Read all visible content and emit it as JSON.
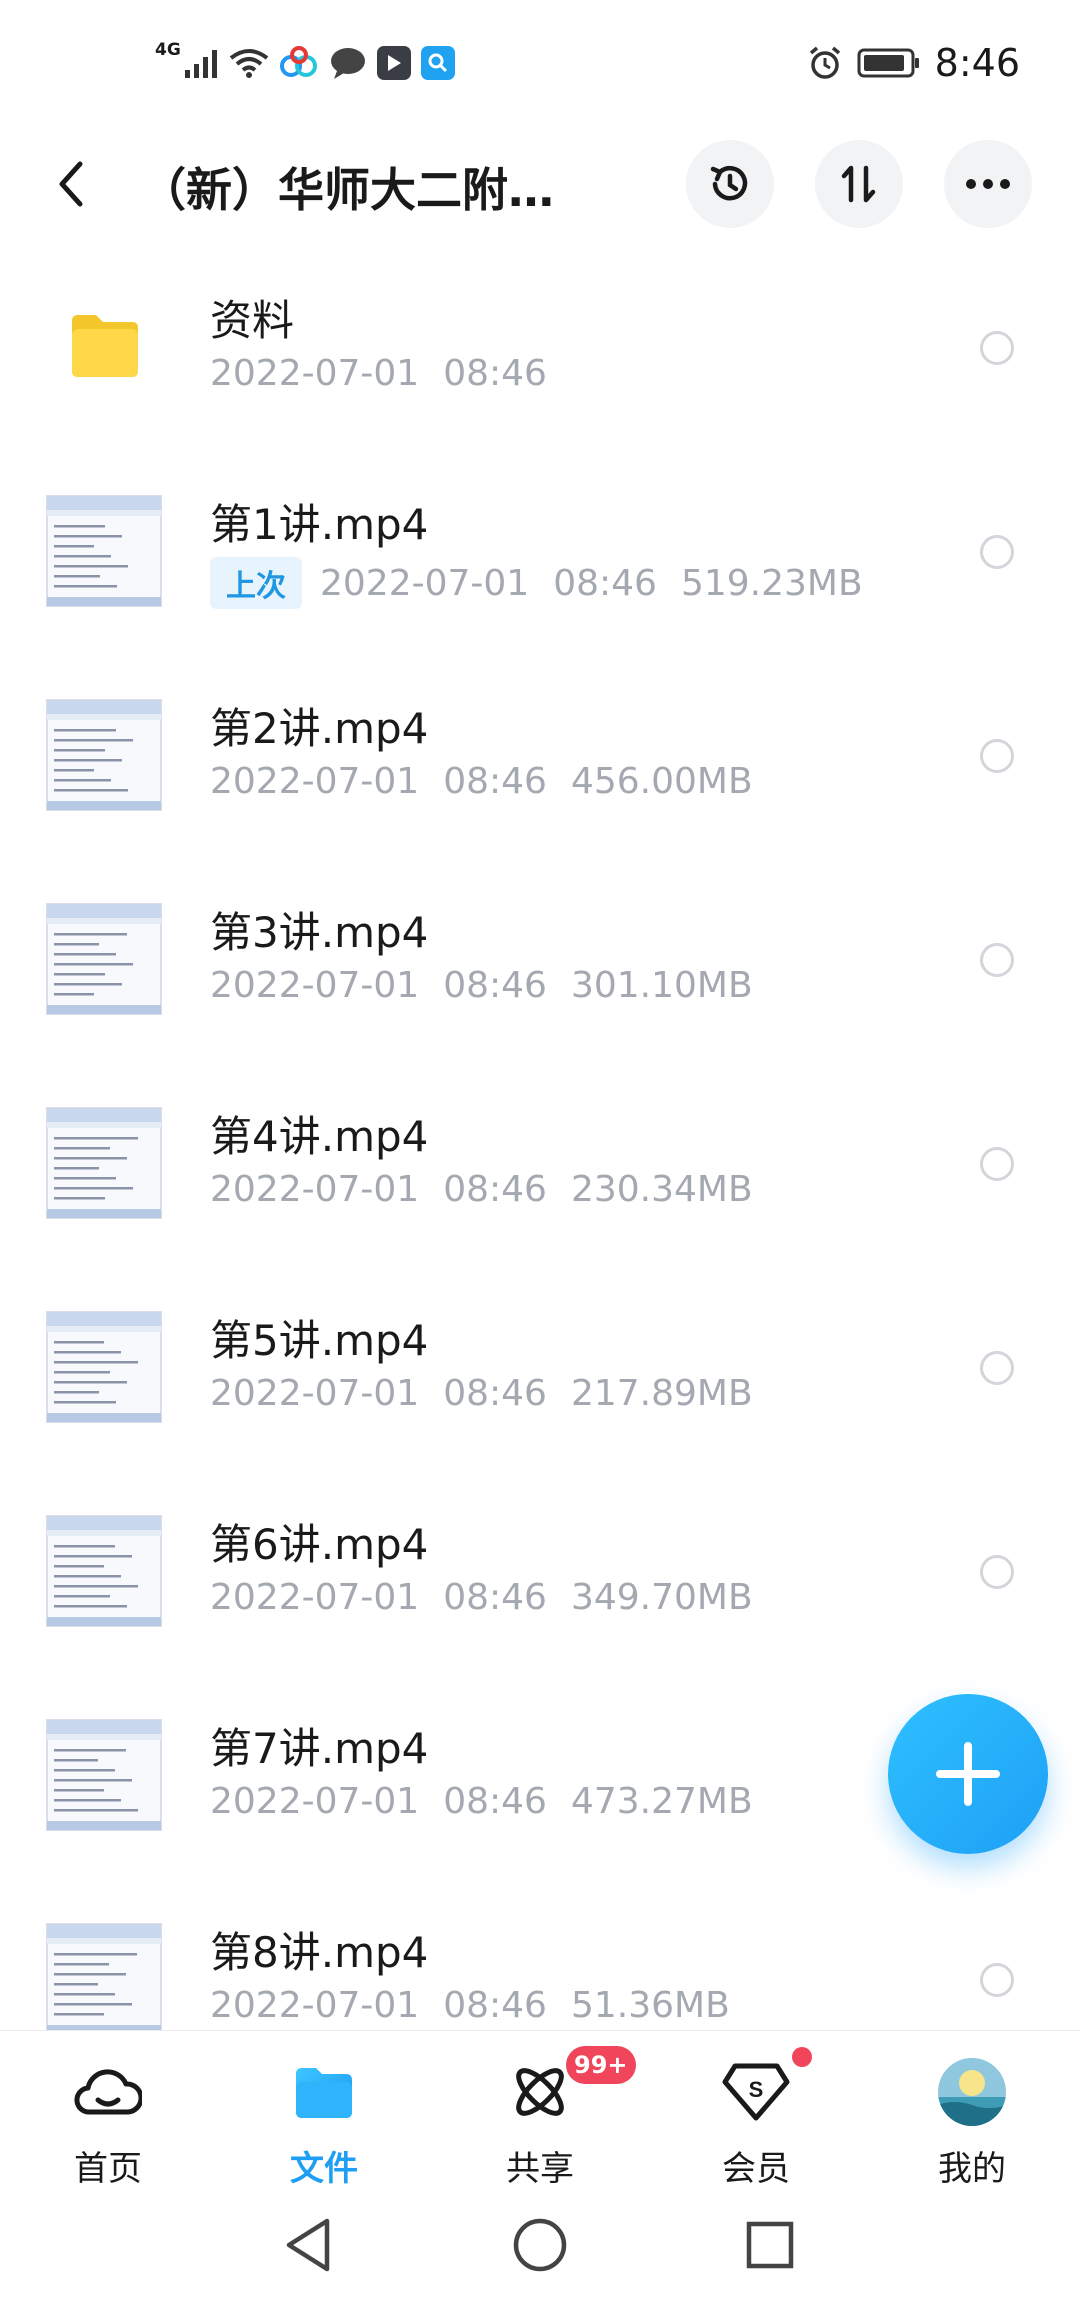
{
  "status_bar": {
    "network_type": "4G",
    "time": "8:46",
    "icons": [
      "signal-icon",
      "wifi-icon",
      "baidu-netdisk-icon",
      "message-icon",
      "video-app-icon",
      "search-app-icon",
      "alarm-icon",
      "battery-icon"
    ]
  },
  "header": {
    "title": "（新）华师大二附…",
    "icons": [
      "back-icon",
      "history-icon",
      "sort-icon",
      "more-icon"
    ]
  },
  "files": [
    {
      "name": "资料",
      "date": "2022-07-01",
      "time": "08:46",
      "size": "",
      "type": "folder",
      "tag": ""
    },
    {
      "name": "第1讲.mp4",
      "date": "2022-07-01",
      "time": "08:46",
      "size": "519.23MB",
      "type": "video",
      "tag": "上次"
    },
    {
      "name": "第2讲.mp4",
      "date": "2022-07-01",
      "time": "08:46",
      "size": "456.00MB",
      "type": "video",
      "tag": ""
    },
    {
      "name": "第3讲.mp4",
      "date": "2022-07-01",
      "time": "08:46",
      "size": "301.10MB",
      "type": "video",
      "tag": ""
    },
    {
      "name": "第4讲.mp4",
      "date": "2022-07-01",
      "time": "08:46",
      "size": "230.34MB",
      "type": "video",
      "tag": ""
    },
    {
      "name": "第5讲.mp4",
      "date": "2022-07-01",
      "time": "08:46",
      "size": "217.89MB",
      "type": "video",
      "tag": ""
    },
    {
      "name": "第6讲.mp4",
      "date": "2022-07-01",
      "time": "08:46",
      "size": "349.70MB",
      "type": "video",
      "tag": ""
    },
    {
      "name": "第7讲.mp4",
      "date": "2022-07-01",
      "time": "08:46",
      "size": "473.27MB",
      "type": "video",
      "tag": ""
    },
    {
      "name": "第8讲.mp4",
      "date": "2022-07-01",
      "time": "08:46",
      "size": "51.36MB",
      "type": "video",
      "tag": ""
    }
  ],
  "fab": {
    "icon": "plus-icon"
  },
  "bottom_nav": {
    "items": [
      {
        "label": "首页",
        "icon": "cloud-home-icon",
        "active": false
      },
      {
        "label": "文件",
        "icon": "folder-icon",
        "active": true
      },
      {
        "label": "共享",
        "icon": "share-atom-icon",
        "active": false
      },
      {
        "label": "会员",
        "icon": "vip-diamond-icon",
        "active": false
      },
      {
        "label": "我的",
        "icon": "avatar-icon",
        "active": false
      }
    ],
    "share_badge": "99+"
  },
  "colors": {
    "accent": "#1e9ff5",
    "badge": "#f0455a",
    "folder": "#ffd540",
    "meta_text": "#a4a8b0",
    "tag_bg": "#e8f4fd"
  }
}
